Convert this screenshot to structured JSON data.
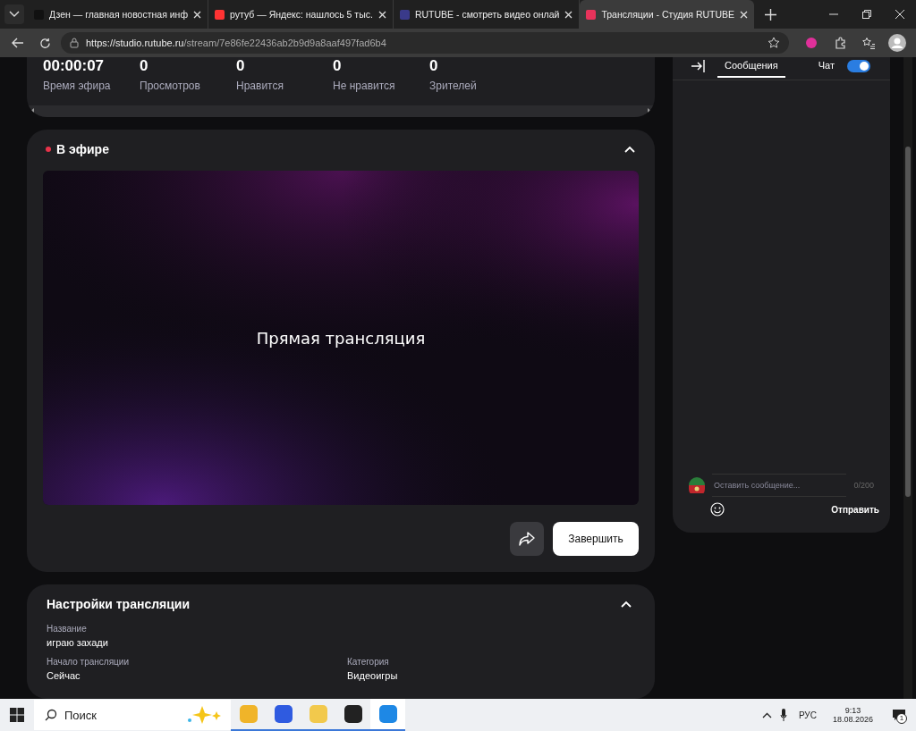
{
  "browser": {
    "tabs": [
      {
        "title": "Дзен — главная новостная инф",
        "selected": false
      },
      {
        "title": "рутуб — Яндекс: нашлось 5 тыс.",
        "selected": false
      },
      {
        "title": "RUTUBE - смотреть видео онлай",
        "selected": false
      },
      {
        "title": "Трансляции - Студия RUTUBE",
        "selected": true
      }
    ],
    "address": {
      "host": "https://studio.rutube.ru",
      "path": "/stream/7e86fe22436ab2b9d9a8aaf497fad6b4"
    }
  },
  "stats": [
    {
      "value": "00:00:07",
      "label": "Время эфира"
    },
    {
      "value": "0",
      "label": "Просмотров"
    },
    {
      "value": "0",
      "label": "Нравится"
    },
    {
      "value": "0",
      "label": "Не нравится"
    },
    {
      "value": "0",
      "label": "Зрителей"
    }
  ],
  "live": {
    "title": "В эфире",
    "expanded": true,
    "preview_text": "Прямая трансляция",
    "finish_button": "Завершить"
  },
  "settings": {
    "title": "Настройки трансляции",
    "expanded": true,
    "fields": [
      {
        "label": "Название",
        "value": "играю захади"
      },
      {
        "label": "Начало трансляции",
        "value": "Сейчас"
      },
      {
        "label": "Категория",
        "value": "Видеоигры"
      }
    ]
  },
  "chat": {
    "tabs": [
      {
        "label": "Сообщения",
        "selected": true
      }
    ],
    "toggle": {
      "label": "Чат",
      "on": true
    },
    "input": {
      "placeholder": "Оставить сообщение...",
      "counter": "0/200"
    },
    "send_button": "Отправить"
  },
  "taskbar": {
    "search_placeholder": "Поиск",
    "apps": [
      {
        "kind": "folder",
        "selected": false
      },
      {
        "kind": "roblox",
        "selected": false
      },
      {
        "kind": "chat",
        "selected": false
      },
      {
        "kind": "obs",
        "selected": false
      },
      {
        "kind": "edge",
        "selected": true
      }
    ],
    "language": "РУС",
    "time": "9:13",
    "date": "18.08.2026",
    "notifications": "1"
  }
}
